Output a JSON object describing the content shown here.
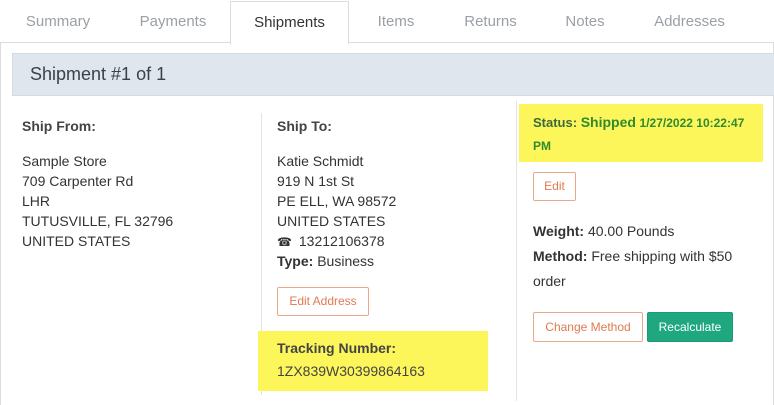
{
  "tabs": [
    {
      "label": "Summary"
    },
    {
      "label": "Payments"
    },
    {
      "label": "Shipments"
    },
    {
      "label": "Items"
    },
    {
      "label": "Returns"
    },
    {
      "label": "Notes"
    },
    {
      "label": "Addresses"
    }
  ],
  "shipment": {
    "title": "Shipment #1 of 1",
    "ship_from": {
      "title": "Ship From:",
      "lines": [
        "Sample Store",
        "709 Carpenter Rd",
        "LHR",
        "TUTUSVILLE, FL 32796",
        "UNITED STATES"
      ]
    },
    "ship_to": {
      "title": "Ship To:",
      "lines": [
        "Katie Schmidt",
        "919 N 1st St",
        "PE ELL, WA 98572",
        "UNITED STATES"
      ],
      "phone": "13212106378",
      "type_label": "Type:",
      "type_value": "Business",
      "edit_address_label": "Edit Address",
      "tracking_label": "Tracking Number:",
      "tracking_number": "1ZX839W30399864163"
    },
    "status": {
      "label": "Status:",
      "value": "Shipped",
      "datetime_part1": "1/27/2022 10:22:47",
      "datetime_part2": "PM",
      "edit_label": "Edit"
    },
    "weight_label": "Weight:",
    "weight_value": "40.00 Pounds",
    "method_label": "Method:",
    "method_value_line1": "Free shipping with $50",
    "method_value_line2": "order",
    "change_method_label": "Change Method",
    "recalculate_label": "Recalculate"
  },
  "colors": {
    "highlight": "#fdf65a",
    "accent_orange": "#e07a50",
    "button_green": "#1fa880",
    "status_green": "#2e8b2e"
  }
}
